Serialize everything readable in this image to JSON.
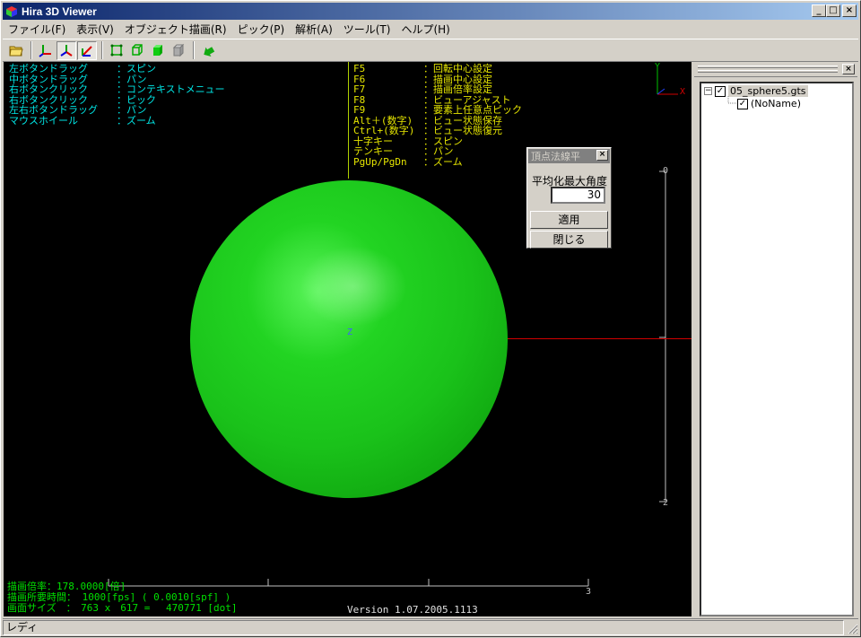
{
  "window": {
    "title": "Hira 3D Viewer",
    "min_label": "_",
    "max_label": "□",
    "close_label": "×"
  },
  "menu": {
    "items": [
      "ファイル(F)",
      "表示(V)",
      "オブジェクト描画(R)",
      "ピック(P)",
      "解析(A)",
      "ツール(T)",
      "ヘルプ(H)"
    ]
  },
  "toolbar": {
    "buttons": [
      "open-folder-icon",
      "axes-xyz-icon",
      "axes-pressed-icon",
      "axes-red-icon",
      "wireframe-icon",
      "cube-icon",
      "solid-cube-icon",
      "gray-cube-icon",
      "arrow-icon"
    ]
  },
  "help_left": [
    {
      "key": "左ボタンドラッグ",
      "val": "：スピン"
    },
    {
      "key": "中ボタンドラッグ",
      "val": "：パン"
    },
    {
      "key": "右ボタンクリック",
      "val": "：コンテキストメニュー"
    },
    {
      "key": "右ボタンクリック",
      "val": "：ピック"
    },
    {
      "key": "左右ボタンドラッグ",
      "val": "：パン"
    },
    {
      "key": "マウスホイール",
      "val": "：ズーム"
    }
  ],
  "help_right": [
    {
      "key": "F5",
      "val": "：回転中心設定"
    },
    {
      "key": "F6",
      "val": "：描画中心設定"
    },
    {
      "key": "F7",
      "val": "：描画倍率設定"
    },
    {
      "key": "F8",
      "val": "：ビューアジャスト"
    },
    {
      "key": "F9",
      "val": "：要素上任意点ピック"
    },
    {
      "key": "Alt＋(数字)",
      "val": "：ビュー状態保存"
    },
    {
      "key": "Ctrl+(数字)",
      "val": "：ビュー状態復元"
    },
    {
      "key": "十字キー",
      "val": "：スピン"
    },
    {
      "key": "テンキー",
      "val": "：パン"
    },
    {
      "key": "PgUp/PgDn",
      "val": "：ズーム"
    }
  ],
  "axis": {
    "y": "Y",
    "x": "X",
    "z": "Z"
  },
  "scale": {
    "v_top": "0",
    "v_bottom": "2",
    "h_right": "3"
  },
  "status_lines": {
    "zoom": "描画倍率：178.0000[倍]",
    "time": "描画所要時間： 1000[fps] ( 0.0010[spf] )",
    "size": "画面サイズ　：　763 x　617 = 　470771 [dot]"
  },
  "version": "Version 1.07.2005.1113",
  "dialog": {
    "title": "頂点法線平",
    "label": "平均化最大角度",
    "value": "30",
    "apply": "適用",
    "close": "閉じる"
  },
  "tree": {
    "root": "05_sphere5.gts",
    "child": "(NoName)",
    "expander": "−",
    "check": "✓"
  },
  "statusbar": {
    "text": "レディ"
  }
}
